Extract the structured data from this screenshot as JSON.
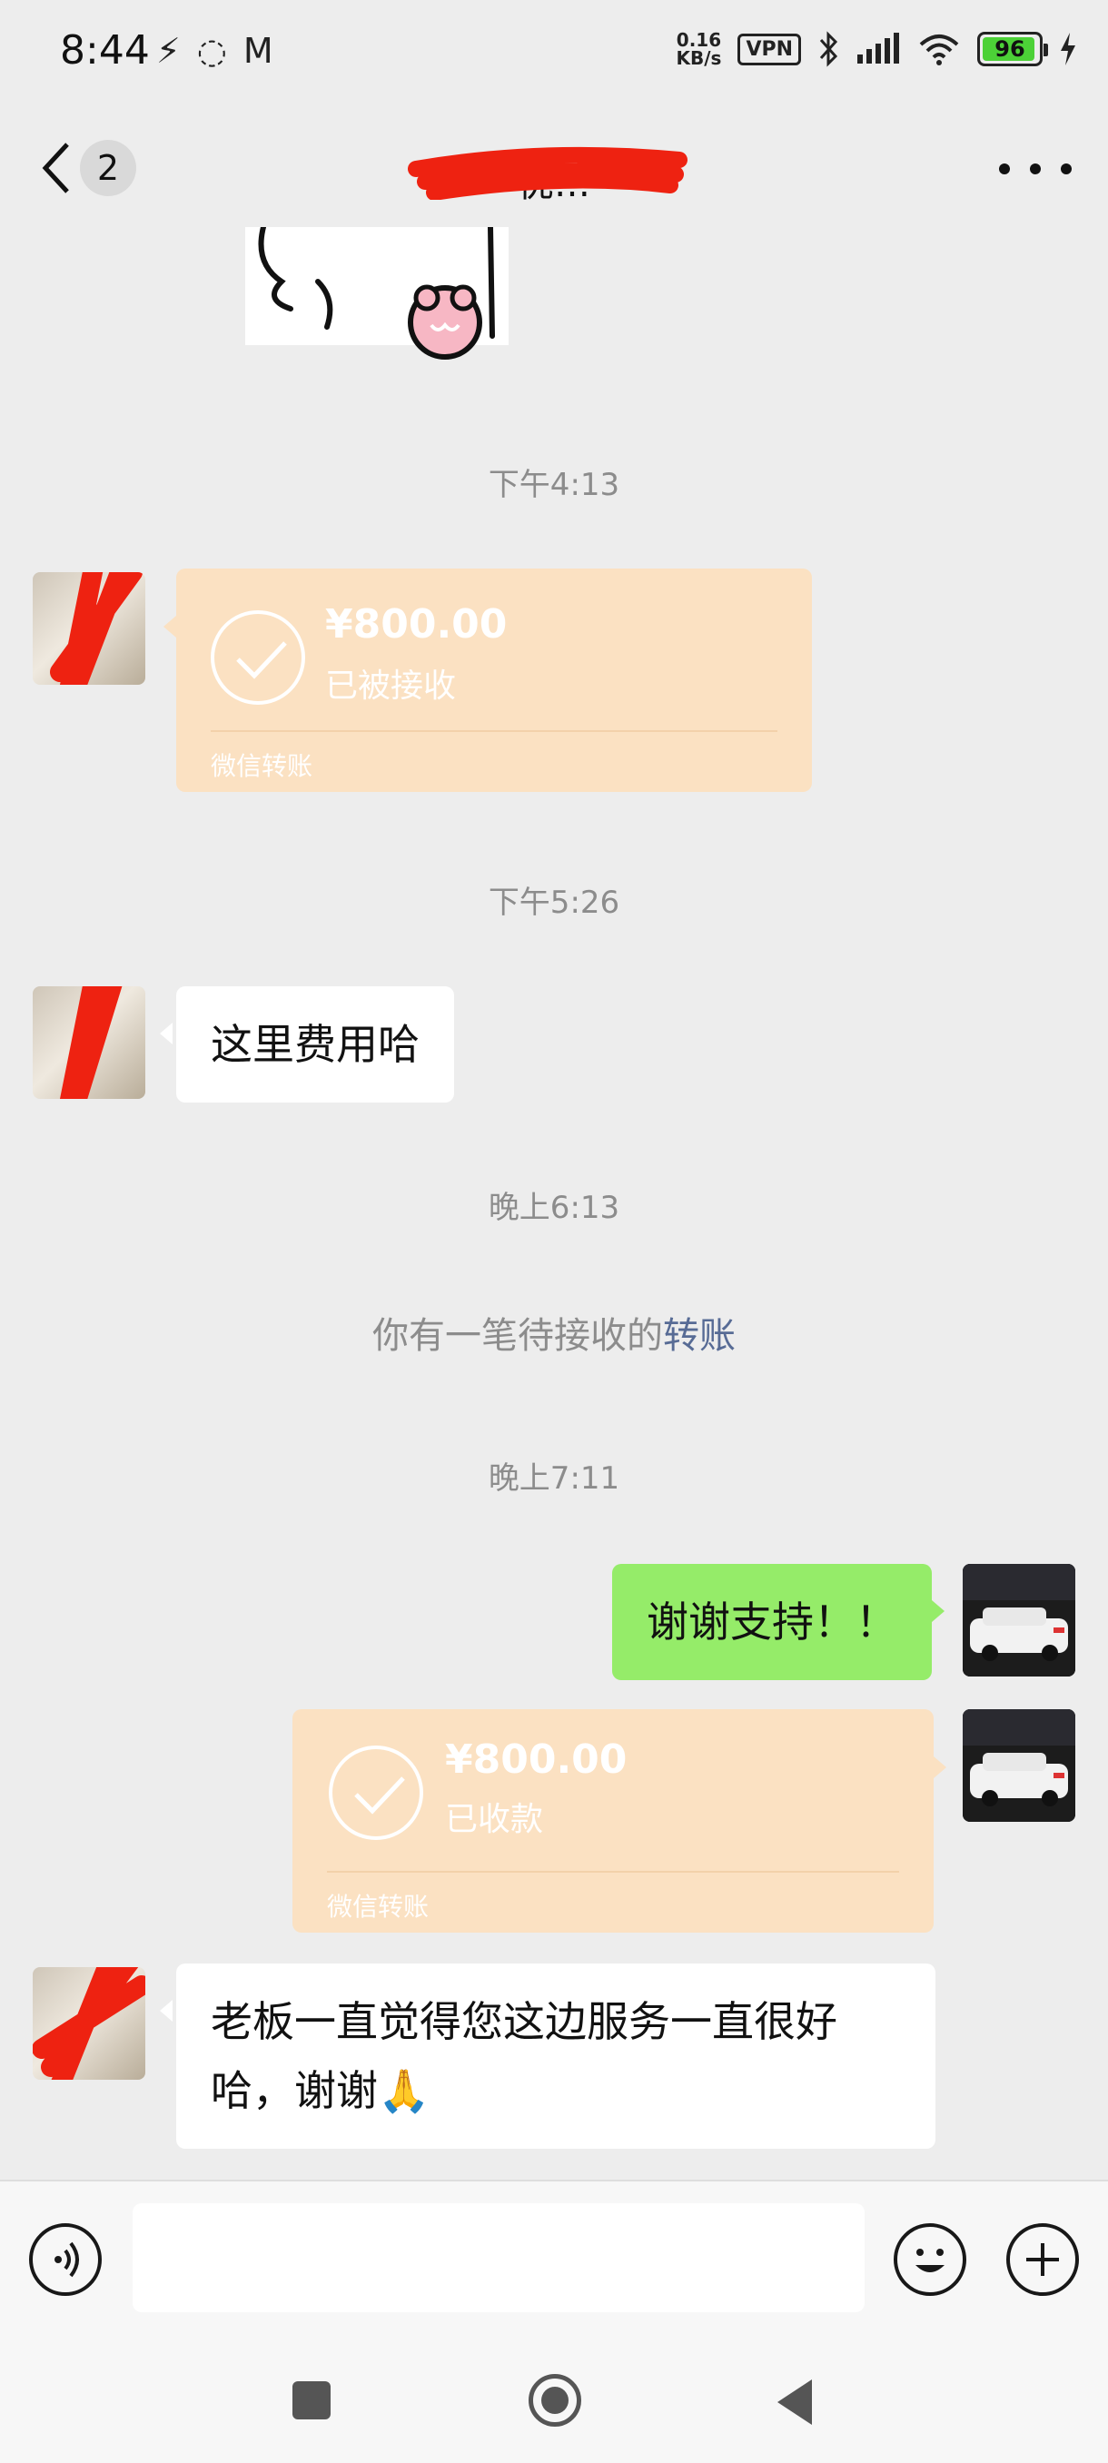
{
  "status_bar": {
    "time": "8:44",
    "net_speed_value": "0.16",
    "net_speed_unit": "KB/s",
    "vpn": "VPN",
    "battery": "96"
  },
  "nav": {
    "unread_count": "2",
    "title": "优…"
  },
  "messages": {
    "ts1": "下午4:13",
    "transfer1": {
      "amount": "¥800.00",
      "status": "已被接收",
      "footer": "微信转账"
    },
    "ts2": "下午5:26",
    "text1": "这里费用哈",
    "ts3": "晚上6:13",
    "system_prefix": "你有一笔待接收的",
    "system_link": "转账",
    "ts4": "晚上7:11",
    "text2": "谢谢支持！！",
    "transfer2": {
      "amount": "¥800.00",
      "status": "已收款",
      "footer": "微信转账"
    },
    "text3_line1": "老板一直觉得您这边服务一直很好",
    "text3_line2": "哈，谢谢🙏"
  },
  "icons": {
    "voice": "voice-icon",
    "emoji": "emoji-icon",
    "plus": "plus-icon",
    "check": "check-icon"
  },
  "colors": {
    "background": "#ededed",
    "incoming_bubble": "#ffffff",
    "outgoing_bubble": "#95ec69",
    "transfer_card": "#fbe1c2",
    "link": "#576b95",
    "redaction": "#ee2211"
  }
}
